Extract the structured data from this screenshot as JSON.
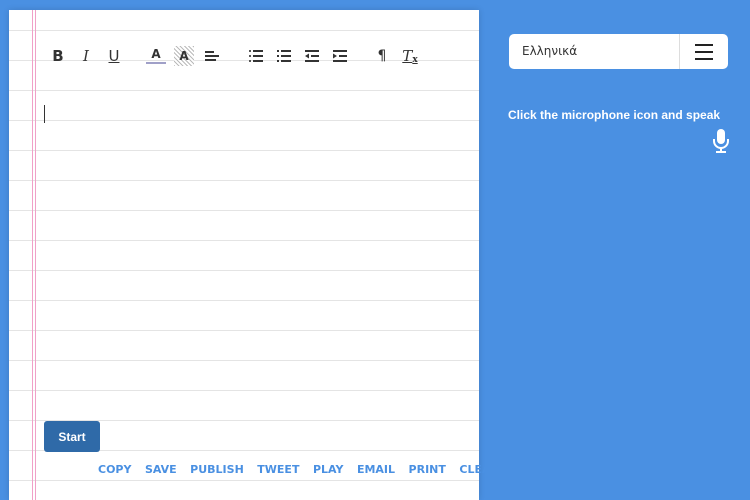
{
  "toolbar": {
    "bold": "B",
    "italic": "I",
    "underline": "U",
    "font_color": "A",
    "highlight": "A",
    "paragraph": "¶",
    "clear_format": "T"
  },
  "editor": {
    "content": ""
  },
  "start_label": "Start",
  "actions": [
    "COPY",
    "SAVE",
    "PUBLISH",
    "TWEET",
    "PLAY",
    "EMAIL",
    "PRINT",
    "CLEAR"
  ],
  "language": {
    "selected": "Ελληνικά"
  },
  "hint": "Click the microphone icon and speak",
  "colors": {
    "background": "#4a90e2",
    "start_button": "#2f6aa8",
    "action_link": "#4a90e2"
  }
}
